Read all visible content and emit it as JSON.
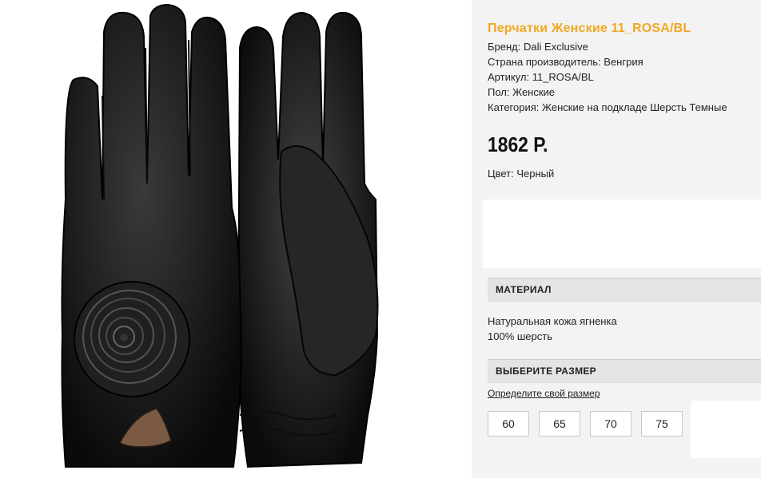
{
  "product": {
    "title": "Перчатки Женские 11_ROSA/BL",
    "image_alt": "black-leather-gloves-with-rose",
    "attributes": [
      {
        "text": "Бренд: Dali Exclusive"
      },
      {
        "text": "Страна производитель: Венгрия"
      },
      {
        "text": "Артикул: 11_ROSA/BL"
      },
      {
        "text": "Пол: Женские"
      },
      {
        "text": "Категория: Женские на подкладе Шерсть Темные"
      }
    ],
    "price": "1862 Р.",
    "color": "Цвет: Черный"
  },
  "material": {
    "header": "МАТЕРИАЛ",
    "lines": [
      "Натуральная кожа ягненка",
      "100% шерсть"
    ]
  },
  "size": {
    "header": "ВЫБЕРИТЕ РАЗМЕР",
    "link": "Определите свой размер",
    "options": [
      "60",
      "65",
      "70",
      "75"
    ]
  },
  "colors": {
    "title": "#f0a820",
    "panel_bg": "#f3f3f3",
    "section_bg": "#e4e4e4",
    "glove": "#1a1a1a"
  }
}
